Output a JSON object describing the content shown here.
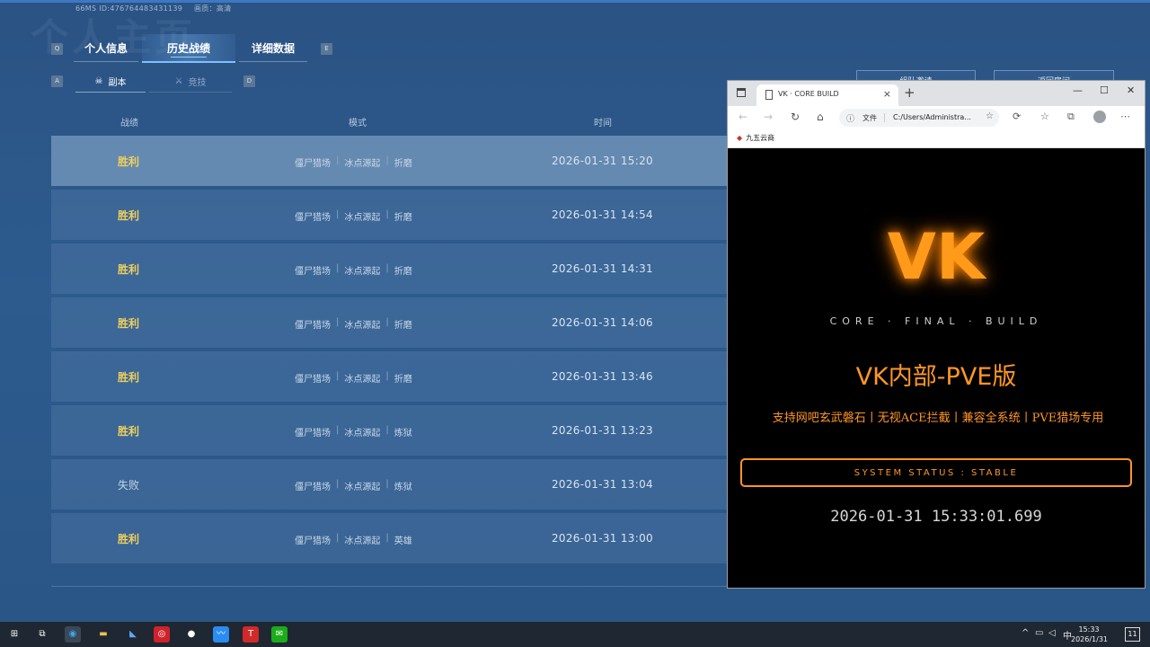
{
  "game": {
    "info_line": "66MS  ID:476764483431139",
    "info_quality": "画质：高清",
    "watermark": "个人主页",
    "key_q": "Q",
    "key_e": "E",
    "key_a": "A",
    "key_d": "D",
    "tabs": [
      {
        "label": "个人信息"
      },
      {
        "label": "历史战绩"
      },
      {
        "label": "详细数据"
      }
    ],
    "subtabs": [
      {
        "label": "副本",
        "icon": "skull-icon"
      },
      {
        "label": "竞技",
        "icon": "crossed-swords-icon"
      }
    ],
    "top_buttons": [
      {
        "label": "组队邀请"
      },
      {
        "label": "返回房间"
      }
    ],
    "columns": {
      "result": "战绩",
      "mode": "模式",
      "time": "时间"
    },
    "rows": [
      {
        "result": "胜利",
        "m1": "僵尸猎场",
        "m2": "冰点源起",
        "m3": "折磨",
        "time": "2026-01-31 15:20"
      },
      {
        "result": "胜利",
        "m1": "僵尸猎场",
        "m2": "冰点源起",
        "m3": "折磨",
        "time": "2026-01-31 14:54"
      },
      {
        "result": "胜利",
        "m1": "僵尸猎场",
        "m2": "冰点源起",
        "m3": "折磨",
        "time": "2026-01-31 14:31"
      },
      {
        "result": "胜利",
        "m1": "僵尸猎场",
        "m2": "冰点源起",
        "m3": "折磨",
        "time": "2026-01-31 14:06"
      },
      {
        "result": "胜利",
        "m1": "僵尸猎场",
        "m2": "冰点源起",
        "m3": "折磨",
        "time": "2026-01-31 13:46"
      },
      {
        "result": "胜利",
        "m1": "僵尸猎场",
        "m2": "冰点源起",
        "m3": "炼狱",
        "time": "2026-01-31 13:23"
      },
      {
        "result": "失败",
        "m1": "僵尸猎场",
        "m2": "冰点源起",
        "m3": "炼狱",
        "time": "2026-01-31 13:04"
      },
      {
        "result": "胜利",
        "m1": "僵尸猎场",
        "m2": "冰点源起",
        "m3": "英雄",
        "time": "2026-01-31 13:00"
      }
    ]
  },
  "browser": {
    "tab_title": "VK · CORE BUILD",
    "tab_close": "×",
    "new_tab": "+",
    "win_min": "—",
    "win_max": "☐",
    "win_close": "✕",
    "addr_file_label": "文件",
    "addr_url": "C:/Users/Administra...",
    "favorites": [
      {
        "label": "九五云商"
      }
    ]
  },
  "page": {
    "logo": "VK",
    "subtitle": "CORE · FINAL · BUILD",
    "product": "VK内部-PVE版",
    "features": "支持网吧玄武磐石丨无视ACE拦截丨兼容全系统丨PVE猎场专用",
    "status": "SYSTEM STATUS : STABLE",
    "clock": "2026-01-31 15:33:01.699",
    "accent_color": "#ff9624"
  },
  "taskbar": {
    "ime": "中",
    "time": "15:33",
    "date": "2026/1/31",
    "notif_count": "11"
  }
}
